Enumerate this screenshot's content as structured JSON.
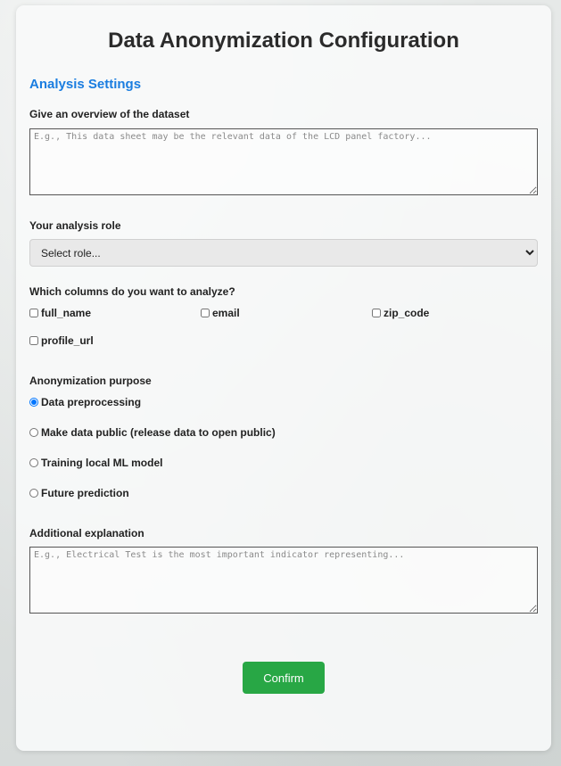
{
  "title": "Data Anonymization Configuration",
  "section": "Analysis Settings",
  "overview": {
    "label": "Give an overview of the dataset",
    "placeholder": "E.g., This data sheet may be the relevant data of the LCD panel factory...",
    "value": ""
  },
  "role": {
    "label": "Your analysis role",
    "selected": "Select role..."
  },
  "columns": {
    "label": "Which columns do you want to analyze?",
    "items": [
      {
        "label": "full_name",
        "checked": false
      },
      {
        "label": "email",
        "checked": false
      },
      {
        "label": "zip_code",
        "checked": false
      },
      {
        "label": "profile_url",
        "checked": false
      }
    ]
  },
  "purpose": {
    "label": "Anonymization purpose",
    "options": [
      {
        "label": "Data preprocessing",
        "checked": true
      },
      {
        "label": "Make data public (release data to open public)",
        "checked": false
      },
      {
        "label": "Training local ML model",
        "checked": false
      },
      {
        "label": "Future prediction",
        "checked": false
      }
    ]
  },
  "explanation": {
    "label": "Additional explanation",
    "placeholder": "E.g., Electrical Test is the most important indicator representing...",
    "value": ""
  },
  "confirm_label": "Confirm",
  "colors": {
    "accent": "#1a7de0",
    "confirm": "#28a745"
  }
}
